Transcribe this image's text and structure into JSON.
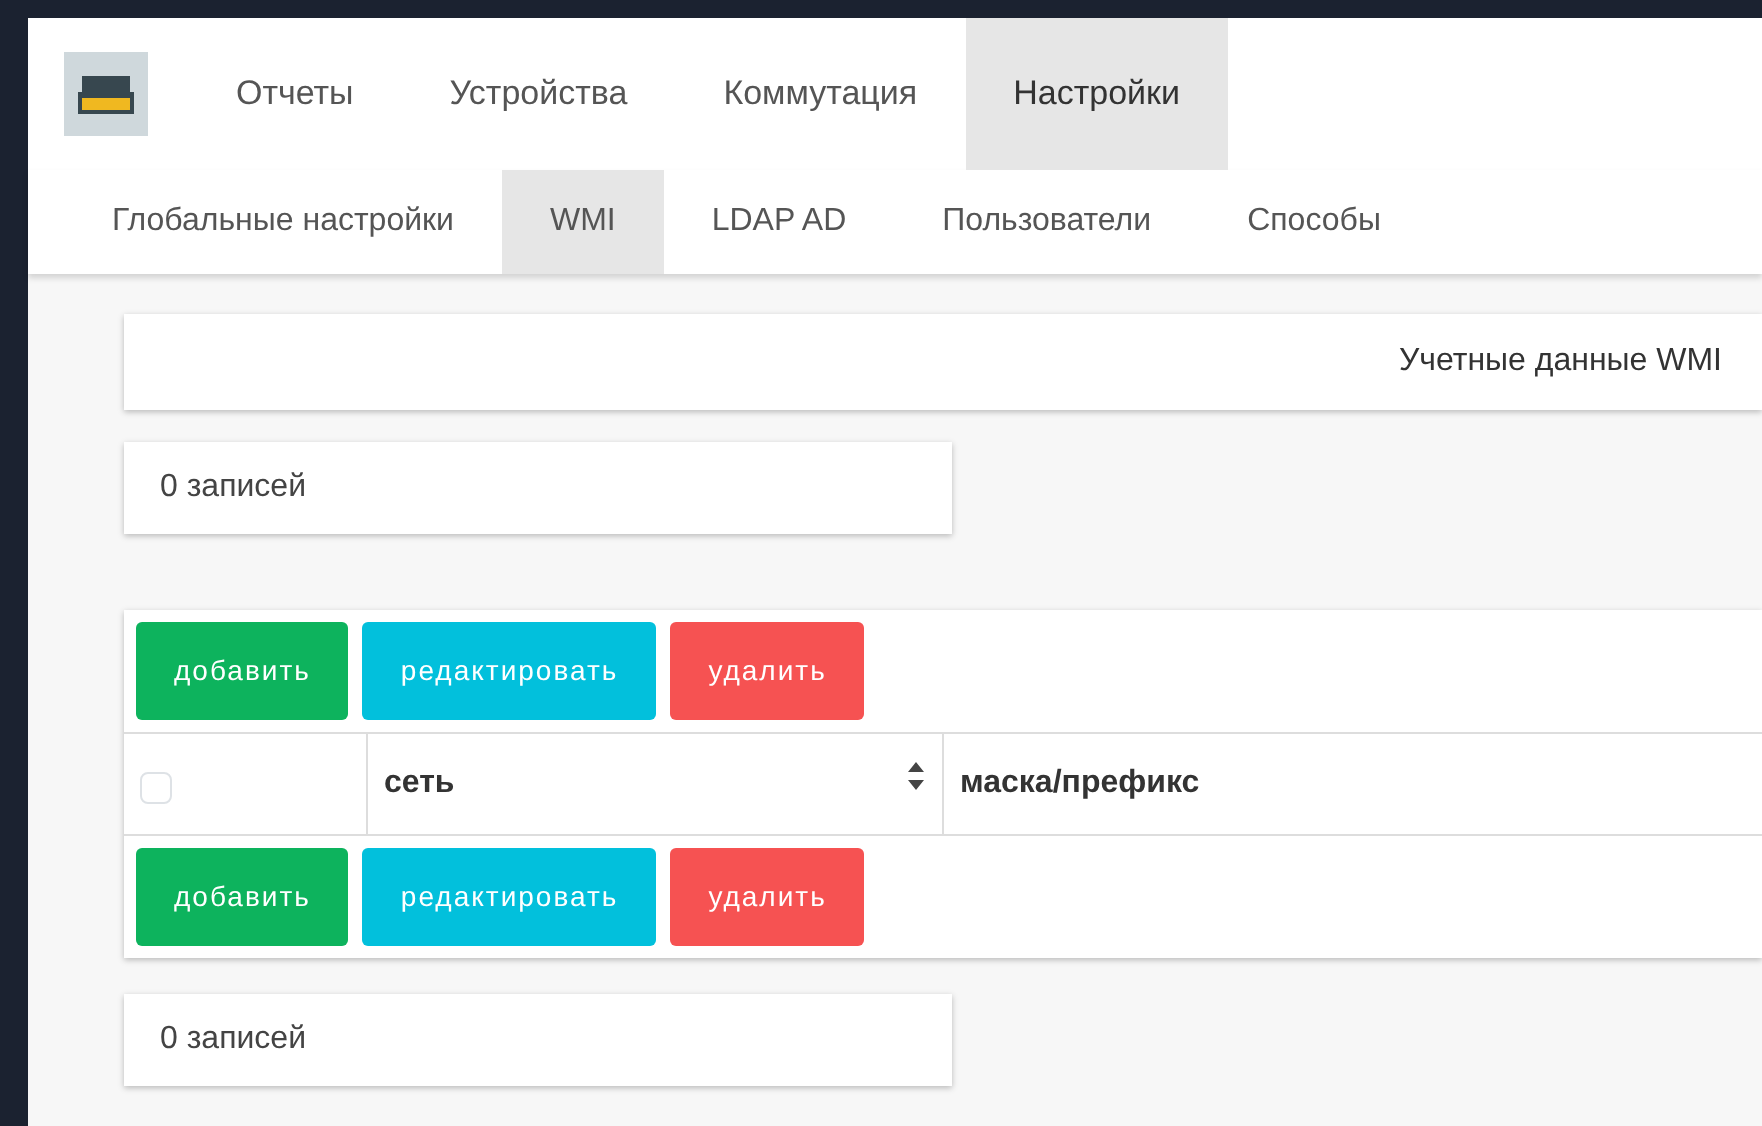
{
  "main_nav": [
    {
      "label": "Отчеты",
      "selected": false
    },
    {
      "label": "Устройства",
      "selected": false
    },
    {
      "label": "Коммутация",
      "selected": false
    },
    {
      "label": "Настройки",
      "selected": true
    }
  ],
  "sub_nav": [
    {
      "label": "Глобальные настройки",
      "selected": false
    },
    {
      "label": "WMI",
      "selected": true
    },
    {
      "label": "LDAP AD",
      "selected": false
    },
    {
      "label": "Пользователи",
      "selected": false
    },
    {
      "label": "Способы",
      "selected": false
    }
  ],
  "panel_title": "Учетные данные WMI",
  "record_count_top": "0 записей",
  "toolbar_top": [
    {
      "label": "добавить",
      "kind": "add"
    },
    {
      "label": "редактировать",
      "kind": "edit"
    },
    {
      "label": "удалить",
      "kind": "delete"
    }
  ],
  "table": {
    "select_all_checked": false,
    "columns": [
      {
        "label": "сеть",
        "sortable": true
      },
      {
        "label": "маска/префикс",
        "sortable": false
      }
    ]
  },
  "toolbar_bottom": [
    {
      "label": "добавить",
      "kind": "add"
    },
    {
      "label": "редактировать",
      "kind": "edit"
    },
    {
      "label": "удалить",
      "kind": "delete"
    }
  ],
  "record_count_bottom": "0 записей"
}
